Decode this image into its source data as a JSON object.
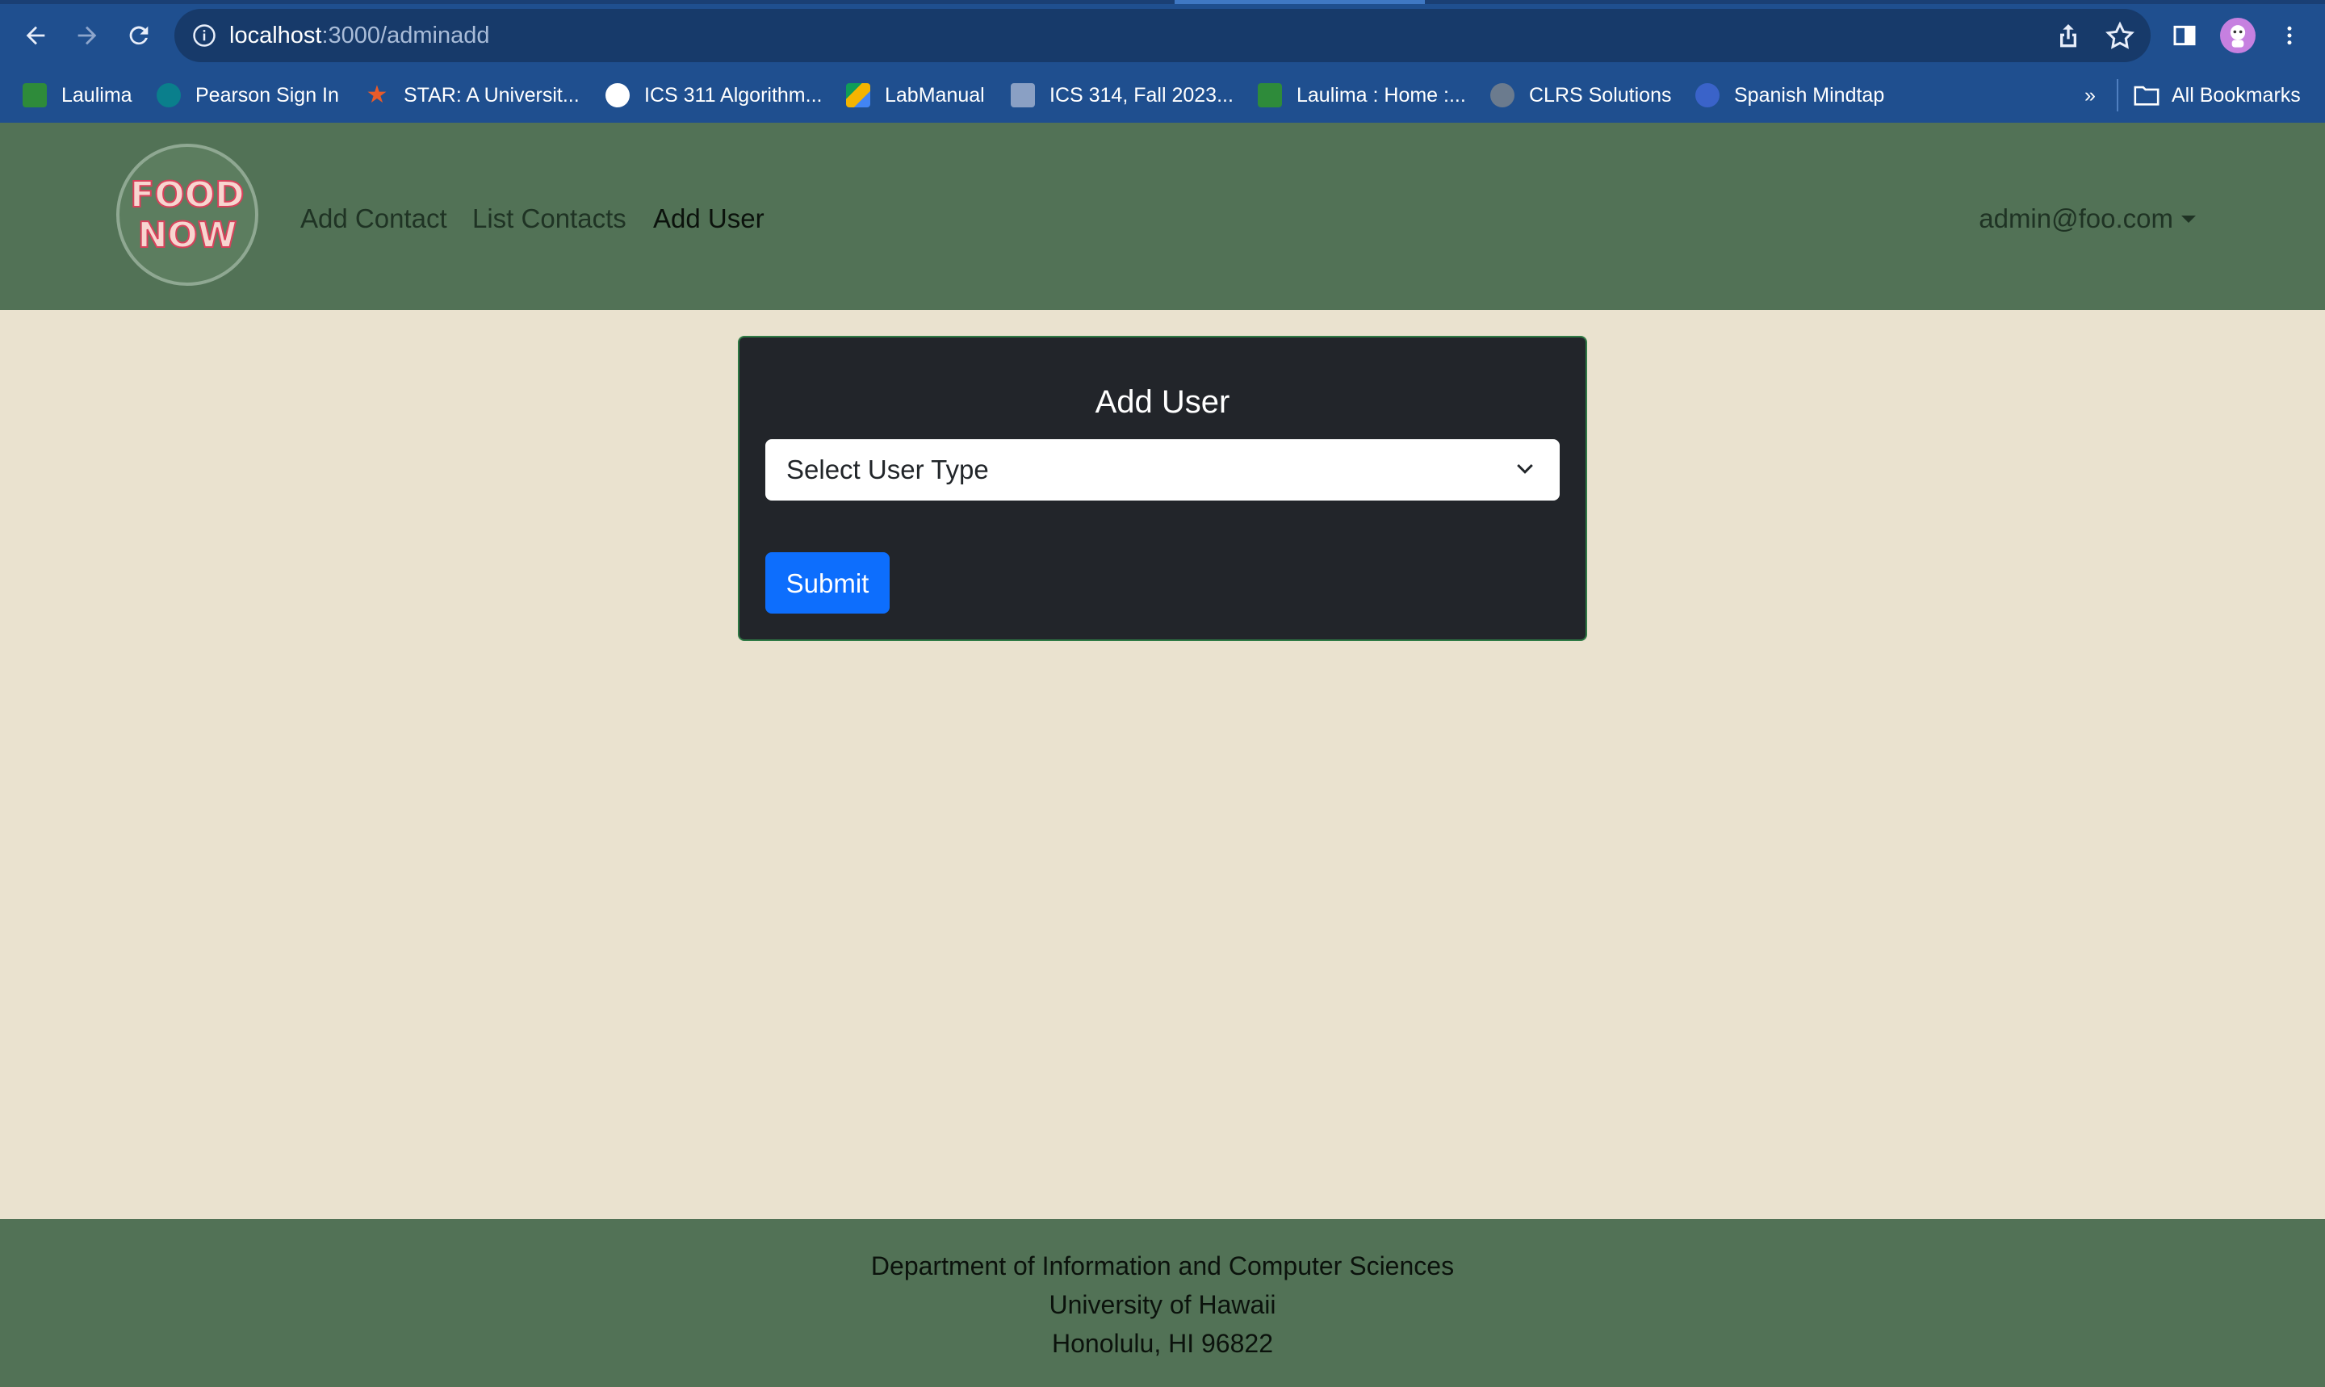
{
  "browser": {
    "url_host": "localhost",
    "url_rest": ":3000/adminadd",
    "bookmarks": [
      {
        "label": "Laulima",
        "icon": "laulima-icon",
        "color": "#2e8b3a"
      },
      {
        "label": "Pearson Sign In",
        "icon": "pearson-icon",
        "color": "#0a7f8c"
      },
      {
        "label": "STAR: A Universit...",
        "icon": "star-icon",
        "color": "#e85b2a"
      },
      {
        "label": "ICS 311 Algorithm...",
        "icon": "globe-icon",
        "color": "#ffffff"
      },
      {
        "label": "LabManual",
        "icon": "drive-icon",
        "color": "#f4b400"
      },
      {
        "label": "ICS 314, Fall 2023...",
        "icon": "page-icon",
        "color": "#8aa0c4"
      },
      {
        "label": "Laulima : Home :...",
        "icon": "laulima-icon",
        "color": "#2e8b3a"
      },
      {
        "label": "CLRS Solutions",
        "icon": "clrs-icon",
        "color": "#6b7b8e"
      },
      {
        "label": "Spanish Mindtap",
        "icon": "mindtap-icon",
        "color": "#3a63c9"
      }
    ],
    "overflow_label": "»",
    "all_bookmarks_label": "All Bookmarks"
  },
  "navbar": {
    "links": [
      {
        "label": "Add Contact"
      },
      {
        "label": "List Contacts"
      },
      {
        "label": "Add User"
      }
    ],
    "user_menu": "admin@foo.com",
    "logo_text_top": "FOOD",
    "logo_text_bottom": "NOW"
  },
  "form": {
    "title": "Add User",
    "select_value": "Select User Type",
    "submit_label": "Submit"
  },
  "footer": {
    "line1": "Department of Information and Computer Sciences",
    "line2": "University of Hawaii",
    "line3": "Honolulu, HI 96822"
  },
  "colors": {
    "navbar_bg": "#527256",
    "page_bg": "#eae2cf",
    "card_bg": "#22252a",
    "button_bg": "#0d6efd"
  }
}
